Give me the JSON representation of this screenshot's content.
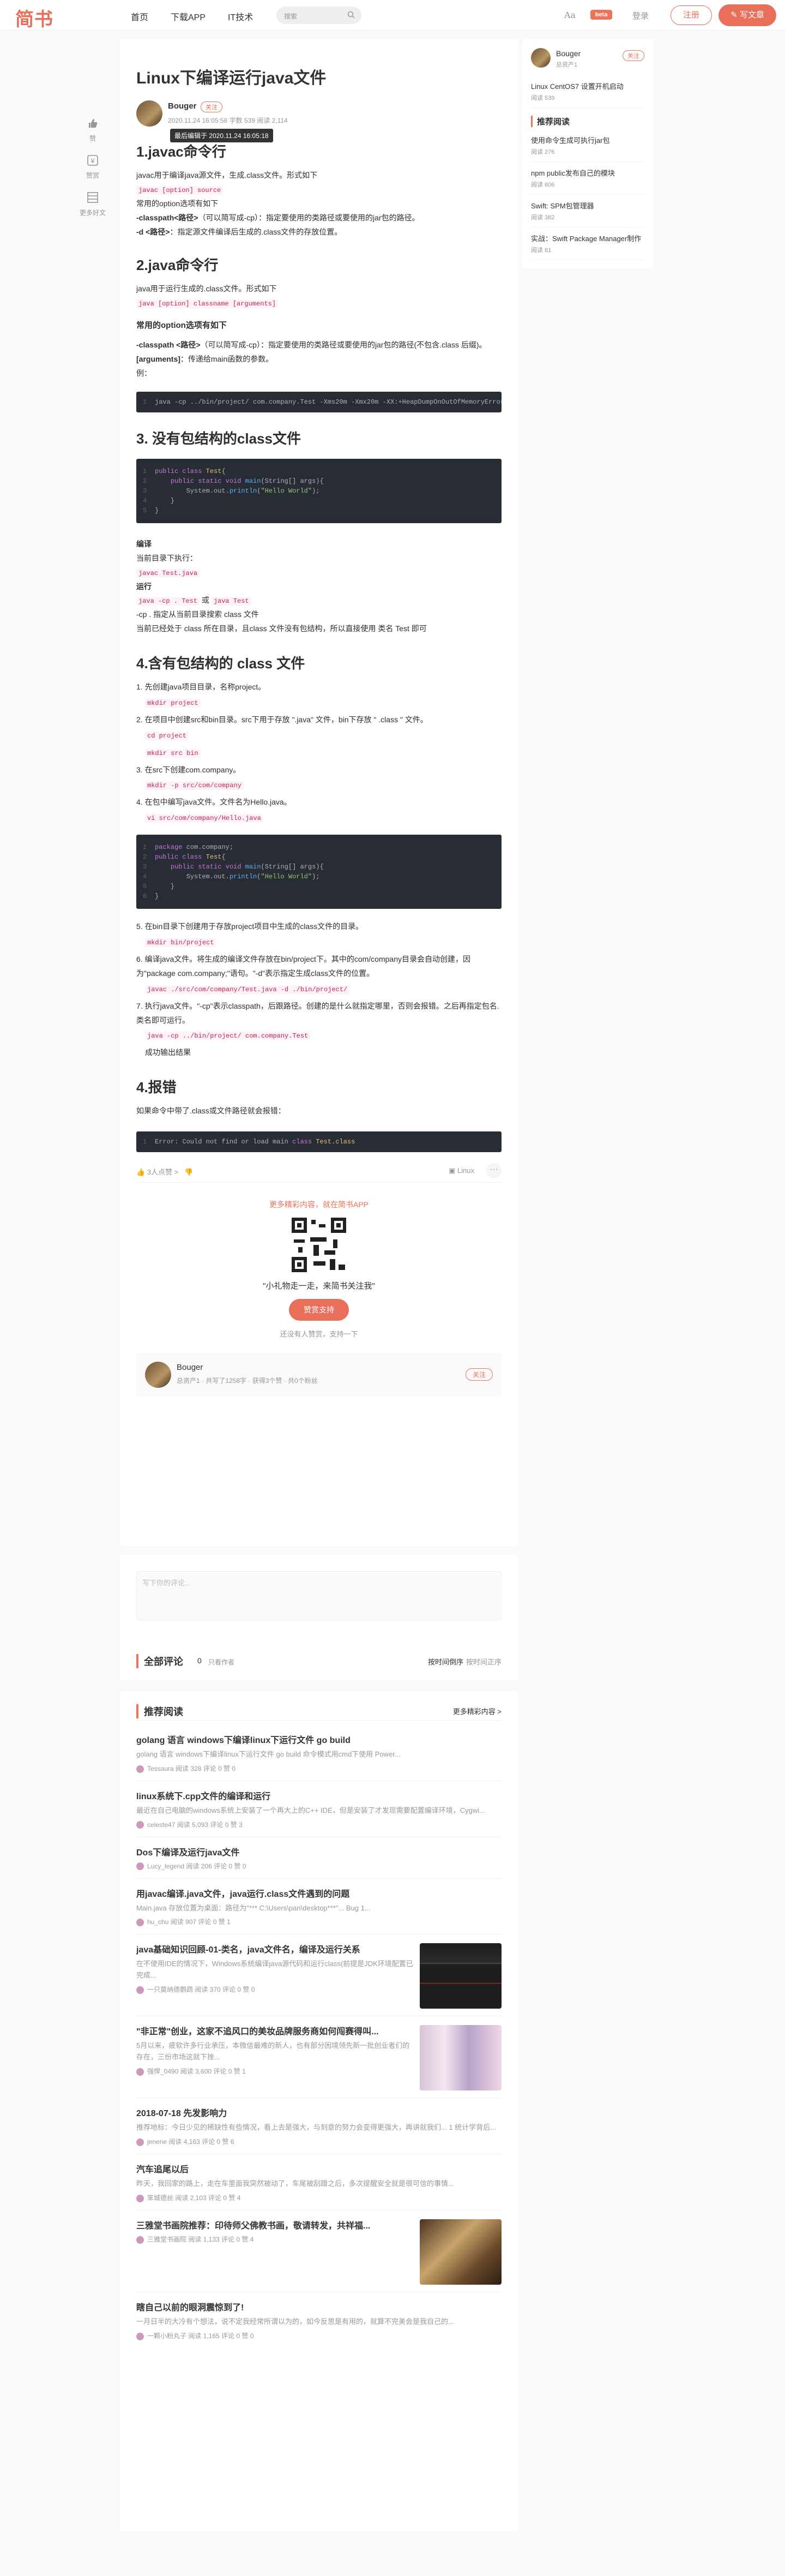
{
  "header": {
    "logo": "简书",
    "nav": [
      "首页",
      "下载APP",
      "IT技术"
    ],
    "search_placeholder": "搜索",
    "aa": "Aa",
    "beta": "beta",
    "login": "登录",
    "register": "注册",
    "write": "写文章"
  },
  "side": {
    "like": "赞",
    "reward": "赞赏",
    "more": "更多好文"
  },
  "article": {
    "title": "Linux下编译运行java文件",
    "author": "Bouger",
    "follow": "关注",
    "meta": "2020.11.24 16:05:58  字数 539  阅读 2,114",
    "tooltip": "最后编辑于 2020.11.24 16:05:18",
    "s1": {
      "h": "1.javac命令行",
      "l1": "javac用于编译java源文件，生成.class文件。形式如下",
      "c1": "javac [option] source",
      "l2": "常用的option选项有如下",
      "p1b": "-classpath<路径>",
      "p1": "（可以简写成-cp）：指定要使用的类路径或要使用的jar包的路径。",
      "p2b": "-d <路径>",
      "p2": "：指定源文件编译后生成的.class文件的存放位置。"
    },
    "s2": {
      "h": "2.java命令行",
      "l1": "java用于运行生成的.class文件。形式如下",
      "c1": "java [option] classname [arguments]",
      "h3": "常用的option选项有如下",
      "p1b": "-classpath <路径>",
      "p1": "（可以简写成-cp）：指定要使用的类路径或要使用的jar包的路径(不包含.class 后缀)。",
      "p2b": "[arguments]",
      "p2": "：传递给main函数的参数。",
      "ex": "例：",
      "code": "java -cp ../bin/project/ com.company.Test -Xms20m -Xmx20m -XX:+HeapDumpOnOutOfMemoryError"
    },
    "s3": {
      "h": "3. 没有包结构的class文件",
      "code": [
        "public class Test{",
        "    public static void main(String[] args){",
        "        System.out.println(\"Hello World\");",
        "    }",
        "}"
      ],
      "b1": "编译",
      "l1": "当前目录下执行：",
      "c1": "javac Test.java",
      "b2": "运行",
      "c2": "java -cp . Test",
      "or": "或",
      "c3": "java Test",
      "l2": "-cp . 指定从当前目录搜索 class 文件",
      "l3": "当前已经处于 class 所在目录，且class 文件没有包结构，所以直接使用 类名 Test 即可"
    },
    "s4": {
      "h": "4.含有包结构的 class 文件",
      "st1": "1. 先创建java项目目录，名称project。",
      "st1c": "mkdir project",
      "st2": "2. 在项目中创建src和bin目录。src下用于存放 \".java\" 文件，bin下存放 \" .class \" 文件。",
      "st2c1": "cd project",
      "st2c2": "mkdir src bin",
      "st3": "3. 在src下创建com.company。",
      "st3c": "mkdir -p src/com/company",
      "st4": "4. 在包中编写java文件。文件名为Hello.java。",
      "st4c": "vi src/com/company/Hello.java",
      "code": [
        "package com.company;",
        "public class Test{",
        "    public static void main(String[] args){",
        "        System.out.println(\"Hello World\");",
        "    }",
        "}"
      ],
      "st5": "5. 在bin目录下创建用于存放project项目中生成的class文件的目录。",
      "st5c": "mkdir bin/project",
      "st6": "6. 编译java文件。将生成的编译文件存放在bin/project下。其中的com/company目录会自动创建，因为\"package com.company;\"语句。\"-d\"表示指定生成class文件的位置。",
      "st6c": "javac ./src/com/company/Test.java -d ./bin/project/",
      "st7": "7. 执行java文件。\"-cp\"表示classpath，后跟路径。创建的是什么就指定哪里，否则会报错。之后再指定包名.类名即可运行。",
      "st7c": "java -cp ../bin/project/ com.company.Test",
      "st7r": "成功输出结果"
    },
    "s5": {
      "h": "4.报错",
      "l1": "如果命令中带了.class或文件路径就会报错：",
      "code": "Error: Could not find or load main class Test.class"
    },
    "likes": "3人点赞 >",
    "report": "Linux",
    "promo": {
      "t": "更多精彩内容，就在简书APP",
      "quote": "\"小礼物走一走，来简书关注我\"",
      "reward": "赞赏支持",
      "none": "还没有人赞赏，支持一下"
    },
    "abox": {
      "name": "Bouger",
      "desc": "总资产1 · 共写了1258字 · 获得3个赞 · 共0个粉丝",
      "follow": "关注"
    }
  },
  "comments": {
    "placeholder": "写下你的评论...",
    "all": "全部评论",
    "count": "0",
    "only": "只看作者",
    "sort1": "按时间倒序",
    "sort2": "按时间正序"
  },
  "rec": {
    "title": "推荐阅读",
    "more": "更多精彩内容 >",
    "items": [
      {
        "t": "golang 语言 windows下编译linux下运行文件 go build",
        "e": "golang 语言 windows下编译linux下运行文件 go build 命令模式用cmd下使用 Power...",
        "m": "Tessaura  阅读 328  评论 0  赞 0"
      },
      {
        "t": "linux系统下.cpp文件的编译和运行",
        "e": "最近在自己电脑的windows系统上安装了一个再大上的C++ IDE，但是安装了才发现需要配置编译环境，Cygwi...",
        "m": "celeste47  阅读 5,093  评论 0  赞 3"
      },
      {
        "t": "Dos下编译及运行java文件",
        "e": "",
        "m": "Lucy_legend  阅读 206  评论 0  赞 0"
      },
      {
        "t": "用javac编译.java文件，java运行.class文件遇到的问题",
        "e": "Main.java 存放位置为桌面：路径为\"*** C:\\Users\\pan\\desktop***\"... Bug 1...",
        "m": "hu_chu  阅读 907  评论 0  赞 1"
      },
      {
        "t": "java基础知识回顾-01-类名，java文件名，编译及运行关系",
        "e": "在不使用IDE的情况下，Windows系统编译java源代码和运行class(前提是JDK环境配置已完成...",
        "m": "一只莫纳德鹦鹉  阅读 370  评论 0  赞 0"
      },
      {
        "t": "\"非正常\"创业，这家不追风口的美妆品牌服务商如何闯赛得叫...",
        "e": "5月以来，疲软许多行业承压，本微信最难的新人，也有部分困境领先新一批创业者们的存在，三份市场这就下挫...",
        "m": "强悍_0490  阅读 3,600  评论 0  赞 1"
      },
      {
        "t": "2018-07-18 先发影响力",
        "e": "推荐地标：今日少见的稀缺性有些情况，看上去是强大，与刻意的努力会变得更强大，再讲就我们... 1 统计学背后...",
        "m": "jenene  阅读 4,163  评论 0  赞 6"
      },
      {
        "t": "汽车追尾以后",
        "e": "昨天，我回家的路上，走在车里面我突然被动了，车尾被刮蹭之后，多次提醒安全就是很可信的事情...",
        "m": "笨城德丝  阅读 2,103  评论 0  赞 4"
      },
      {
        "t": "三雅堂书画院推荐：印待师父佛教书画，敬请转发，共祥福...",
        "e": "",
        "m": "三雅堂书画院  阅读 1,133  评论 0  赞 4"
      },
      {
        "t": "瞎自己以前的眼洞震惊到了!",
        "e": "一月日半的大冷有个想法，说不定我经常所谓以为的，如今反思是有用的，就算不完美会是我自己的...",
        "m": "一颗小粉丸子  阅读 1,165  评论 0  赞 0"
      }
    ]
  },
  "rside": {
    "author": "Bouger",
    "assets": "总资产1",
    "follow": "关注",
    "post": "Linux CentOS7 设置开机启动",
    "postm": "阅读 539",
    "sec": "推荐阅读",
    "items": [
      {
        "a": "使用命令生成可执行jar包",
        "b": "阅读 276"
      },
      {
        "a": "npm public发布自己的模块",
        "b": "阅读 806"
      },
      {
        "a": "Swift: SPM包管理器",
        "b": "阅读 382"
      },
      {
        "a": "实战：Swift Package Manager制作",
        "b": "阅读 81"
      }
    ]
  }
}
